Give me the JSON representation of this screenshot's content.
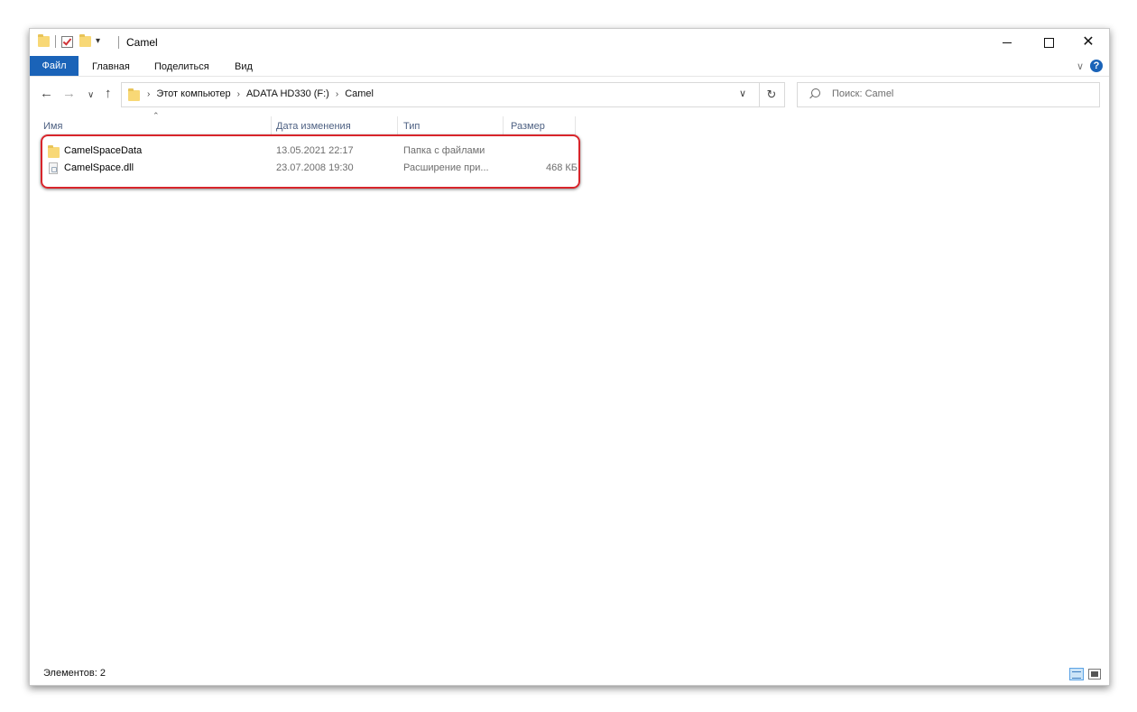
{
  "window": {
    "title": "Camel"
  },
  "ribbon": {
    "tabs": [
      {
        "label": "Файл"
      },
      {
        "label": "Главная"
      },
      {
        "label": "Поделиться"
      },
      {
        "label": "Вид"
      }
    ],
    "help": "?"
  },
  "address": {
    "crumbs": [
      "Этот компьютер",
      "ADATA HD330 (F:)",
      "Camel"
    ]
  },
  "search": {
    "placeholder": "Поиск: Camel"
  },
  "columns": {
    "name": "Имя",
    "date": "Дата изменения",
    "type": "Тип",
    "size": "Размер"
  },
  "files": [
    {
      "name": "CamelSpaceData",
      "date": "13.05.2021 22:17",
      "type": "Папка с файлами",
      "size": "",
      "icon": "folder-icon"
    },
    {
      "name": "CamelSpace.dll",
      "date": "23.07.2008 19:30",
      "type": "Расширение при...",
      "size": "468 КБ",
      "icon": "file-icon"
    }
  ],
  "status": {
    "items": "Элементов: 2"
  },
  "colors": {
    "accent": "#1a63b8",
    "highlight": "#d8252b"
  }
}
